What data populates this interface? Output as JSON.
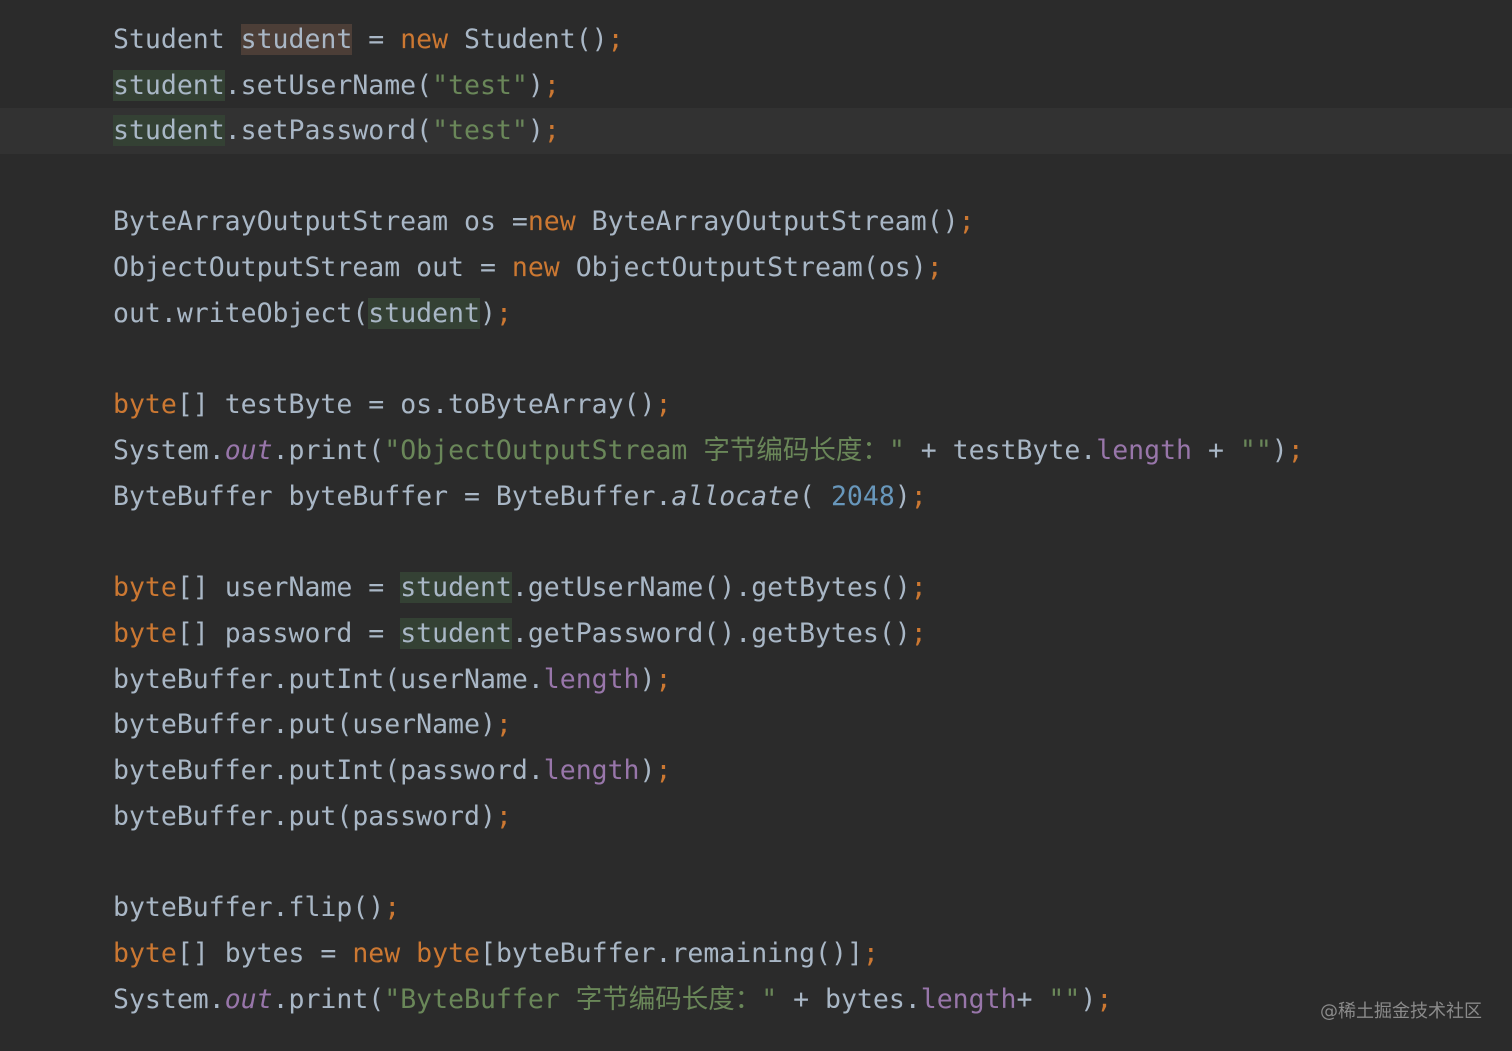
{
  "editor": {
    "lines": [
      [
        {
          "t": "Student ",
          "c": ""
        },
        {
          "t": "student",
          "c": "hl-decl"
        },
        {
          "t": " = ",
          "c": ""
        },
        {
          "t": "new",
          "c": "kw"
        },
        {
          "t": " Student()",
          "c": ""
        },
        {
          "t": ";",
          "c": "kw"
        }
      ],
      [
        {
          "t": "student",
          "c": "hl-usage"
        },
        {
          "t": ".setUserName(",
          "c": ""
        },
        {
          "t": "\"test\"",
          "c": "str"
        },
        {
          "t": ")",
          "c": ""
        },
        {
          "t": ";",
          "c": "kw"
        }
      ],
      [
        {
          "t": "student",
          "c": "hl-usage"
        },
        {
          "t": ".setPassword(",
          "c": ""
        },
        {
          "t": "\"test\"",
          "c": "str"
        },
        {
          "t": ")",
          "c": ""
        },
        {
          "t": ";",
          "c": "kw"
        }
      ],
      [],
      [
        {
          "t": "ByteArrayOutputStream os =",
          "c": ""
        },
        {
          "t": "new",
          "c": "kw"
        },
        {
          "t": " ByteArrayOutputStream()",
          "c": ""
        },
        {
          "t": ";",
          "c": "kw"
        }
      ],
      [
        {
          "t": "ObjectOutputStream out = ",
          "c": ""
        },
        {
          "t": "new",
          "c": "kw"
        },
        {
          "t": " ObjectOutputStream(os)",
          "c": ""
        },
        {
          "t": ";",
          "c": "kw"
        }
      ],
      [
        {
          "t": "out.writeObject(",
          "c": ""
        },
        {
          "t": "student",
          "c": "hl-usage"
        },
        {
          "t": ")",
          "c": ""
        },
        {
          "t": ";",
          "c": "kw"
        }
      ],
      [],
      [
        {
          "t": "byte",
          "c": "kw"
        },
        {
          "t": "[] testByte = os.toByteArray()",
          "c": ""
        },
        {
          "t": ";",
          "c": "kw"
        }
      ],
      [
        {
          "t": "System.",
          "c": ""
        },
        {
          "t": "out",
          "c": "sfld"
        },
        {
          "t": ".print(",
          "c": ""
        },
        {
          "t": "\"ObjectOutputStream 字节编码长度：\"",
          "c": "str"
        },
        {
          "t": " + testByte.",
          "c": ""
        },
        {
          "t": "length",
          "c": "fld"
        },
        {
          "t": " + ",
          "c": ""
        },
        {
          "t": "\"\"",
          "c": "str"
        },
        {
          "t": ")",
          "c": ""
        },
        {
          "t": ";",
          "c": "kw"
        }
      ],
      [
        {
          "t": "ByteBuffer byteBuffer = ByteBuffer.",
          "c": ""
        },
        {
          "t": "allocate",
          "c": "smeth"
        },
        {
          "t": "( ",
          "c": ""
        },
        {
          "t": "2048",
          "c": "num"
        },
        {
          "t": ")",
          "c": ""
        },
        {
          "t": ";",
          "c": "kw"
        }
      ],
      [],
      [
        {
          "t": "byte",
          "c": "kw"
        },
        {
          "t": "[] userName = ",
          "c": ""
        },
        {
          "t": "student",
          "c": "hl-usage"
        },
        {
          "t": ".getUserName().getBytes()",
          "c": ""
        },
        {
          "t": ";",
          "c": "kw"
        }
      ],
      [
        {
          "t": "byte",
          "c": "kw"
        },
        {
          "t": "[] password = ",
          "c": ""
        },
        {
          "t": "student",
          "c": "hl-usage"
        },
        {
          "t": ".getPassword().getBytes()",
          "c": ""
        },
        {
          "t": ";",
          "c": "kw"
        }
      ],
      [
        {
          "t": "byteBuffer.putInt(userName.",
          "c": ""
        },
        {
          "t": "length",
          "c": "fld"
        },
        {
          "t": ")",
          "c": ""
        },
        {
          "t": ";",
          "c": "kw"
        }
      ],
      [
        {
          "t": "byteBuffer.put(userName)",
          "c": ""
        },
        {
          "t": ";",
          "c": "kw"
        }
      ],
      [
        {
          "t": "byteBuffer.putInt(password.",
          "c": ""
        },
        {
          "t": "length",
          "c": "fld"
        },
        {
          "t": ")",
          "c": ""
        },
        {
          "t": ";",
          "c": "kw"
        }
      ],
      [
        {
          "t": "byteBuffer.put(password)",
          "c": ""
        },
        {
          "t": ";",
          "c": "kw"
        }
      ],
      [],
      [
        {
          "t": "byteBuffer.flip()",
          "c": ""
        },
        {
          "t": ";",
          "c": "kw"
        }
      ],
      [
        {
          "t": "byte",
          "c": "kw"
        },
        {
          "t": "[] bytes = ",
          "c": ""
        },
        {
          "t": "new",
          "c": "kw"
        },
        {
          "t": " ",
          "c": ""
        },
        {
          "t": "byte",
          "c": "kw"
        },
        {
          "t": "[byteBuffer.remaining()]",
          "c": ""
        },
        {
          "t": ";",
          "c": "kw"
        }
      ],
      [
        {
          "t": "System.",
          "c": ""
        },
        {
          "t": "out",
          "c": "sfld"
        },
        {
          "t": ".print(",
          "c": ""
        },
        {
          "t": "\"ByteBuffer 字节编码长度：\"",
          "c": "str"
        },
        {
          "t": " + bytes.",
          "c": ""
        },
        {
          "t": "length",
          "c": "fld"
        },
        {
          "t": "+ ",
          "c": ""
        },
        {
          "t": "\"\"",
          "c": "str"
        },
        {
          "t": ")",
          "c": ""
        },
        {
          "t": ";",
          "c": "kw"
        }
      ]
    ],
    "current_line_index": 2
  },
  "watermark": {
    "text": "@稀土掘金技术社区"
  },
  "colors": {
    "background": "#2b2b2b",
    "current_line": "#323232",
    "default_text": "#a9b7c6",
    "keyword": "#cc7832",
    "string": "#6a8759",
    "number": "#6897bb",
    "field": "#9876aa",
    "declaration_highlight": "#4c3e37",
    "usage_highlight": "#344134"
  }
}
